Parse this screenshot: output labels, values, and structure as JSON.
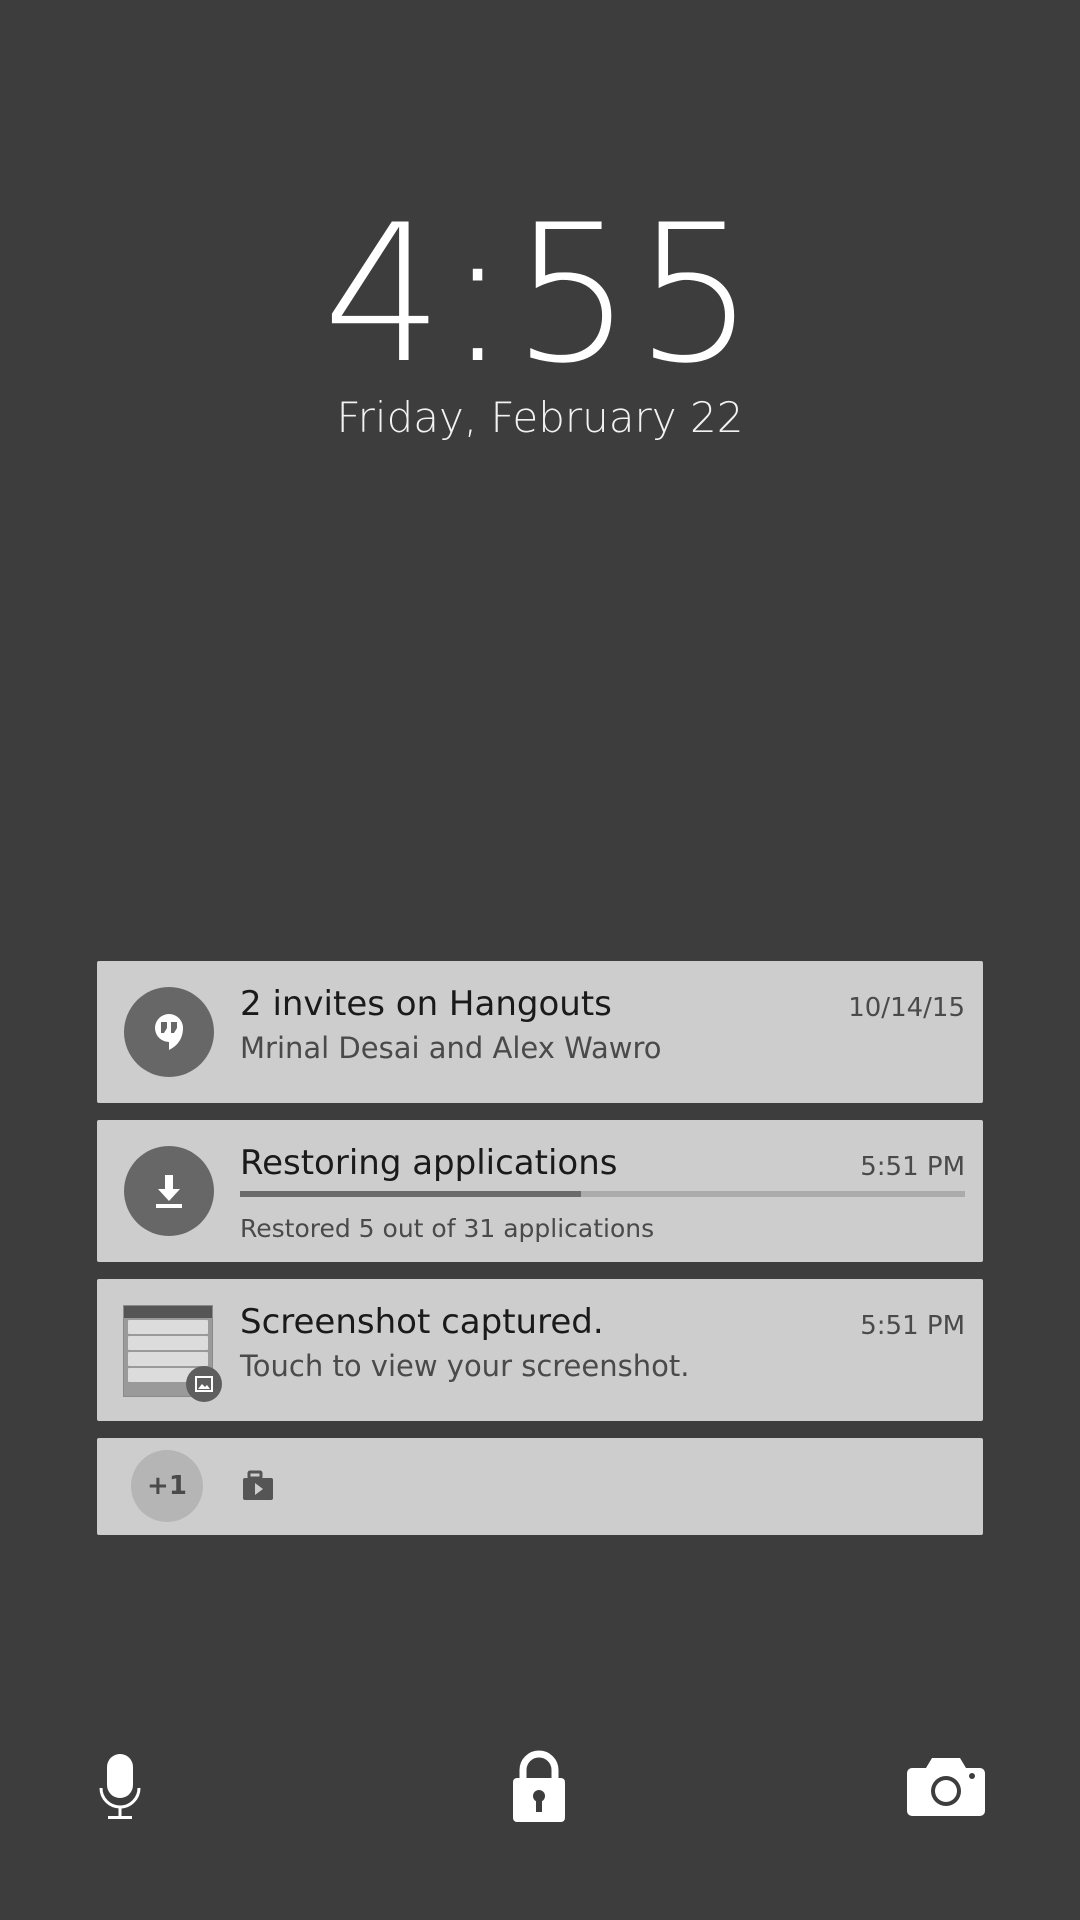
{
  "lockscreen": {
    "time": "4:55",
    "date": "Friday, February 22"
  },
  "notifications": [
    {
      "icon": "hangouts-quote-icon",
      "title": "2 invites on Hangouts",
      "text": "Mrinal Desai and Alex Wawro",
      "time": "10/14/15"
    },
    {
      "icon": "download-icon",
      "title": "Restoring applications",
      "time": "5:51 PM",
      "progress": 0.47,
      "text": "Restored 5 out of 31 applications"
    },
    {
      "icon": "screenshot-thumbnail",
      "badge_icon": "image-icon",
      "title": "Screenshot captured.",
      "text": "Touch to view your screenshot.",
      "time": "5:51 PM"
    },
    {
      "overflow_count": "+1",
      "icon": "play-media-icon"
    }
  ],
  "bottom_actions": [
    "microphone-icon",
    "lock-icon",
    "camera-icon"
  ],
  "colors": {
    "background": "#3d3d3d",
    "card": "#cdcdcd",
    "icon_circle": "#676767"
  }
}
